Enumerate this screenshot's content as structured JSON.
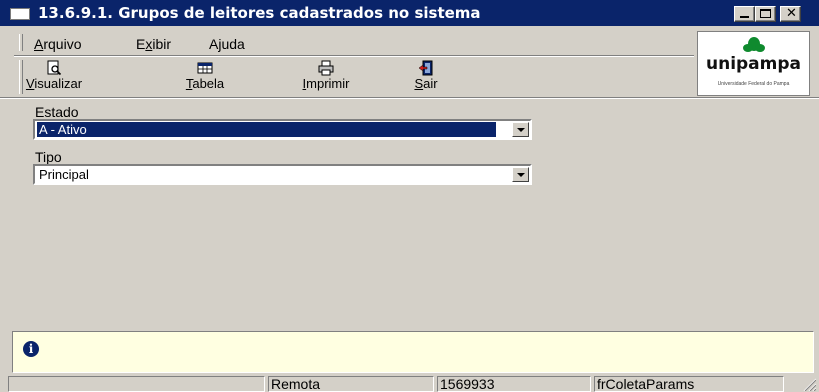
{
  "window": {
    "title": "13.6.9.1. Grupos de leitores cadastrados no sistema",
    "title_bar_color": "#0a246a",
    "controls": [
      "minimize",
      "maximize",
      "close"
    ],
    "close_glyph": "✕"
  },
  "menu": {
    "items": [
      {
        "label": "Arquivo",
        "mnemonic": "A"
      },
      {
        "label": "Exibir",
        "mnemonic": "x"
      },
      {
        "label": "Ajuda",
        "mnemonic": "j"
      }
    ]
  },
  "toolbar": {
    "buttons": [
      {
        "label": "Visualizar",
        "icon": "preview-icon"
      },
      {
        "label": "Tabela",
        "icon": "table-icon"
      },
      {
        "label": "Imprimir",
        "icon": "printer-icon"
      },
      {
        "label": "Sair",
        "icon": "exit-icon"
      }
    ]
  },
  "logo": {
    "name": "unipampa",
    "subtitle": "Universidade Federal do Pampa",
    "leaf_color": "#0f8a2e"
  },
  "form": {
    "estado": {
      "label": "Estado",
      "value": "A - Ativo"
    },
    "tipo": {
      "label": "Tipo",
      "value": "Principal"
    }
  },
  "info": {
    "icon": "info-icon",
    "glyph": "i",
    "background": "#ffffe1"
  },
  "statusbar": {
    "cells": [
      "",
      "Remota",
      "1569933",
      "frColetaParams"
    ]
  }
}
